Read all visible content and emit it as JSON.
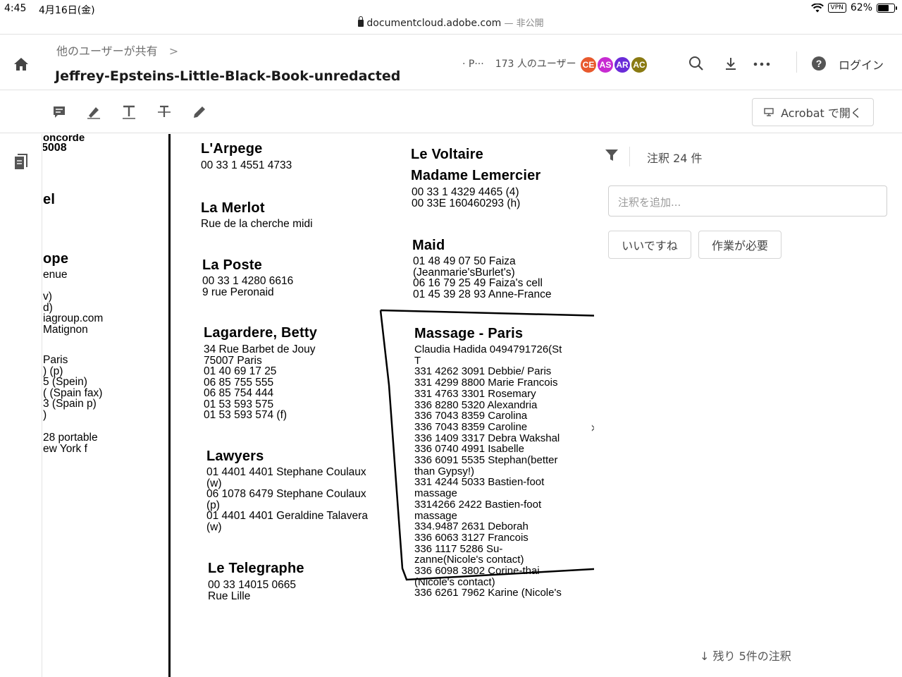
{
  "status_bar": {
    "time": "4:45",
    "date": "4月16日(金)",
    "vpn": "VPN",
    "battery": "62%"
  },
  "url_bar": {
    "domain": "documentcloud.adobe.com",
    "private_label": " — 非公開"
  },
  "header": {
    "breadcrumb": "他のユーザーが共有",
    "breadcrumb_chevron": ">",
    "title": "Jeffrey-Epsteins-Little-Black-Book-unredacted",
    "share_prefix": "· P···",
    "users_count": "173 人のユーザー",
    "avatars": [
      {
        "initials": "CE",
        "color": "#e8592d"
      },
      {
        "initials": "AS",
        "color": "#c72bd1"
      },
      {
        "initials": "AR",
        "color": "#6a2bd8"
      },
      {
        "initials": "AC",
        "color": "#8a7a12"
      }
    ],
    "login": "ログイン"
  },
  "toolbar": {
    "open_acrobat": "Acrobat で開く"
  },
  "document": {
    "col_left": {
      "lines_top": [
        "oncorde",
        "5008"
      ],
      "heading_1": "el",
      "heading_2": "ope",
      "lines_mid": "enue\n\nv)\nd)\niagroup.com\nMatignon",
      "lines_bottom": "Paris\n) (p)\n5 (Spein)\n( (Spain fax)\n3 (Spain p)\n)",
      "lines_end": "28 portable\new York f"
    },
    "col_mid": [
      {
        "heading": "L'Arpege",
        "lines": "00 33 1 4551 4733"
      },
      {
        "heading": "La Merlot",
        "lines": "Rue de la cherche midi"
      },
      {
        "heading": "La Poste",
        "lines": "00 33 1 4280 6616\n9 rue Peronaid"
      },
      {
        "heading": "Lagardere, Betty",
        "lines": "34 Rue Barbet de Jouy\n75007 Paris\n01 40 69 17 25\n06 85 755 555\n06 85 754 444\n01 53 593 575\n01 53 593 574 (f)"
      },
      {
        "heading": "Lawyers",
        "lines": "01 4401 4401 Stephane Coulaux\n(w)\n06 1078 6479 Stephane Coulaux\n(p)\n01 4401 4401 Geraldine Talavera\n(w)"
      },
      {
        "heading": "Le Telegraphe",
        "lines": "00 33 14015 0665\nRue Lille"
      }
    ],
    "col_right": [
      {
        "heading": "Le Voltaire",
        "lines": ""
      },
      {
        "heading": "Madame Lemercier",
        "lines": "00 33 1 4329 4465 (4)\n00 33E 160460293 (h)"
      },
      {
        "heading": "Maid",
        "lines": "01 48 49 07 50 Faiza\n(Jeanmarie'sBurlet's)\n06 16 79 25 49 Faiza's cell\n01 45 39 28 93 Anne-France"
      },
      {
        "heading": "Massage - Paris",
        "lines": "Claudia Hadida 0494791726(St\nT\n331 4262 3091 Debbie/ Paris\n331 4299 8800 Marie Francois\n331 4763 3301 Rosemary\n336 8280 5320 Alexandria\n336 7043 8359 Carolina\n336 7043 8359 Caroline\n336 1409 3317 Debra Wakshal\n336 0740 4991 Isabelle\n336 6091 5535 Stephan(better\nthan Gypsy!)\n331 4244 5033 Bastien-foot\nmassage\n3314266 2422 Bastien-foot\nmassage\n334.9487 2631 Deborah\n336 6063 3127 Francois\n336 1117 5286 Su-\nzanne(Nicole's contact)\n336 6098 3802 Corine-thai\n(Nicole's contact)\n336 6261 7962 Karine (Nicole's"
      }
    ]
  },
  "comments_panel": {
    "count_label": "注釈 24 件",
    "add_placeholder": "注釈を追加...",
    "like_button": "いいですね",
    "needs_work_button": "作業が必要",
    "remaining": "↓ 残り 5件の注釈"
  }
}
